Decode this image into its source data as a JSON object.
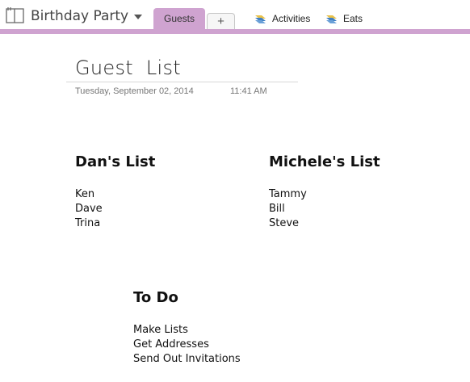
{
  "notebook": {
    "title": "Birthday Party"
  },
  "tabs": {
    "active_label": "Guests",
    "add_label": "+"
  },
  "sections": [
    {
      "label": "Activities",
      "icon": "section-stack-icon"
    },
    {
      "label": "Eats",
      "icon": "section-stack-icon"
    }
  ],
  "colors": {
    "accent": "#cfa3d0",
    "section_blue": "#3f7fc4",
    "section_yellow": "#e8c14a"
  },
  "page": {
    "title": "Guest  List",
    "date": "Tuesday, September 02, 2014",
    "time": "11:41 AM"
  },
  "lists": [
    {
      "heading": "Dan's List",
      "items": [
        "Ken",
        "Dave",
        "Trina"
      ]
    },
    {
      "heading": "Michele's List",
      "items": [
        "Tammy",
        "Bill",
        "Steve"
      ]
    },
    {
      "heading": "To Do",
      "items": [
        "Make Lists",
        "Get Addresses",
        "Send Out Invitations"
      ]
    }
  ]
}
